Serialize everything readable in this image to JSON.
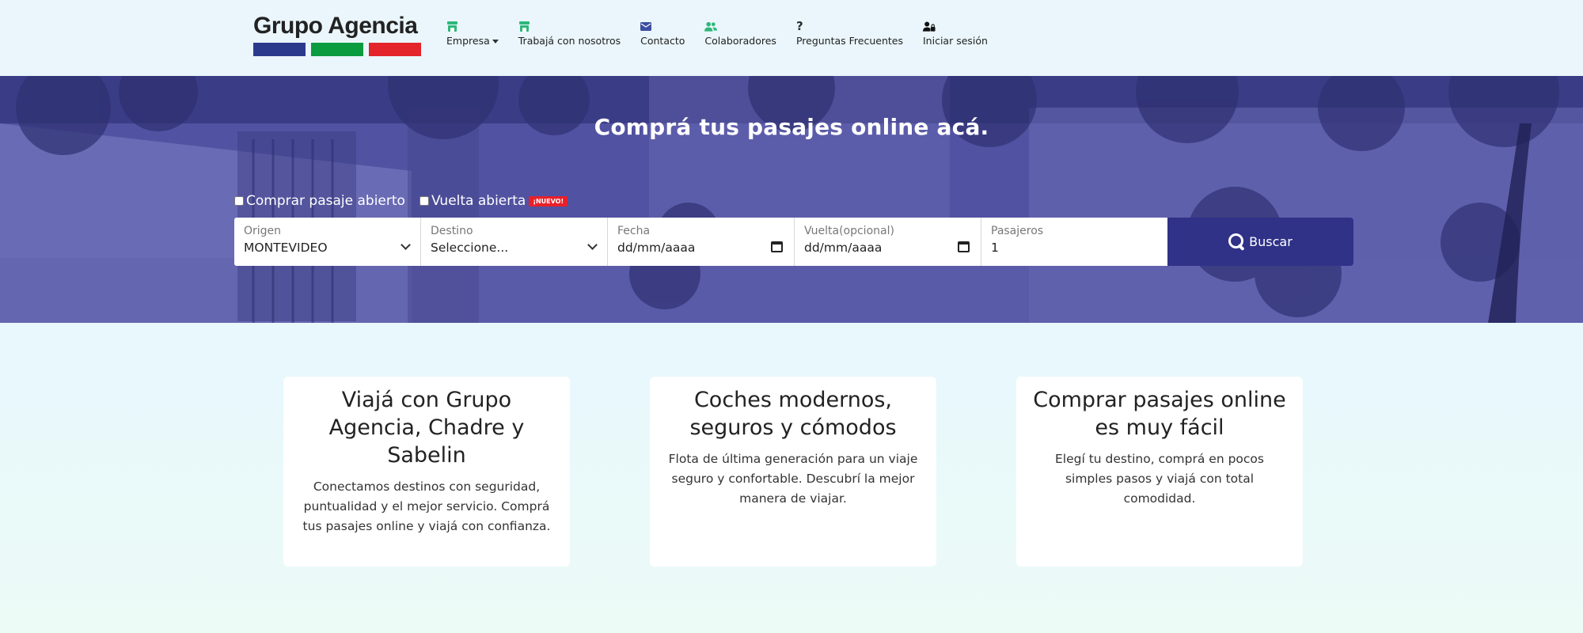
{
  "brand": {
    "name": "Grupo Agencia",
    "bar_colors": [
      "#2c3a8c",
      "#0a9c3f",
      "#e3242b"
    ]
  },
  "nav": [
    {
      "label": "Empresa",
      "icon": "store-icon",
      "icon_color": "#2db87a",
      "dropdown": true
    },
    {
      "label": "Trabajá con nosotros",
      "icon": "store-icon",
      "icon_color": "#2db87a"
    },
    {
      "label": "Contacto",
      "icon": "envelope-icon",
      "icon_color": "#3c4ea1"
    },
    {
      "label": "Colaboradores",
      "icon": "users-icon",
      "icon_color": "#2db87a"
    },
    {
      "label": "Preguntas Frecuentes",
      "icon": "question-icon",
      "icon_glyph": "?",
      "icon_color": "#111"
    },
    {
      "label": "Iniciar sesión",
      "icon": "user-lock-icon",
      "icon_color": "#111"
    }
  ],
  "hero": {
    "title": "Comprá tus pasajes online acá.",
    "checkbox_open": "Comprar pasaje abierto",
    "checkbox_return": "Vuelta abierta",
    "badge": "¡NUEVO!"
  },
  "search": {
    "origin_label": "Origen",
    "origin_value": "MONTEVIDEO",
    "destination_label": "Destino",
    "destination_value": "Seleccione...",
    "date_label": "Fecha",
    "date_value": "dd/mm/aaaa",
    "return_label": "Vuelta(opcional)",
    "return_value": "dd/mm/aaaa",
    "passengers_label": "Pasajeros",
    "passengers_value": "1",
    "button": "Buscar"
  },
  "cards": [
    {
      "title": "Viajá con Grupo Agencia, Chadre y Sabelin",
      "text": "Conectamos destinos con seguridad, puntualidad y el mejor servicio. Comprá tus pasajes online y viajá con confianza."
    },
    {
      "title": "Coches modernos, seguros y cómodos",
      "text": "Flota de última generación para un viaje seguro y confortable. Descubrí la mejor manera de viajar."
    },
    {
      "title": "Comprar pasajes online es muy fácil",
      "text": "Elegí tu destino, comprá en pocos simples pasos y viajá con total comodidad."
    }
  ]
}
